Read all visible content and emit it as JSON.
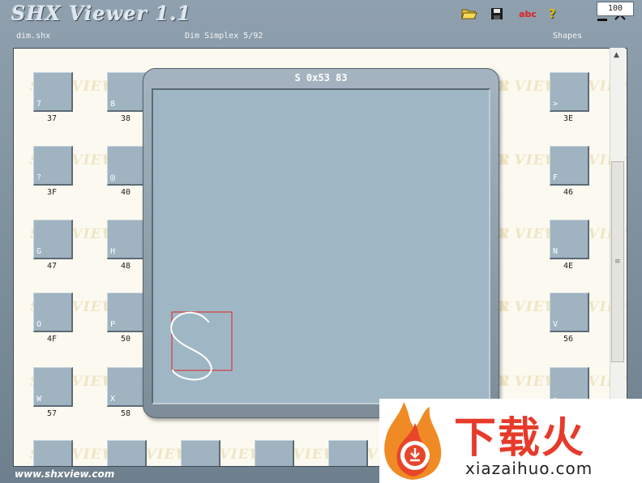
{
  "app": {
    "title": "SHX Viewer 1.1",
    "toolbar": {
      "open_icon": "folder-open-icon",
      "save_icon": "floppy-save-icon",
      "font_label": "abc",
      "help_label": "?"
    },
    "window_controls": {
      "minimize": "minimize-icon",
      "close": "close-icon"
    }
  },
  "status": {
    "file": "dim.shx",
    "font_info": "Dim Simplex 5/92",
    "mode": "Shapes",
    "count": "100"
  },
  "watermark_text": "SHX VIEWER",
  "shapes": {
    "rows": [
      [
        {
          "g": "7",
          "c": "37"
        },
        {
          "g": "8",
          "c": "38"
        },
        null,
        null,
        null,
        null,
        null,
        {
          "g": ">",
          "c": "3E"
        }
      ],
      [
        {
          "g": "?",
          "c": "3F"
        },
        {
          "g": "@",
          "c": "40"
        },
        null,
        null,
        null,
        null,
        null,
        {
          "g": "F",
          "c": "46"
        }
      ],
      [
        {
          "g": "G",
          "c": "47"
        },
        {
          "g": "H",
          "c": "48"
        },
        null,
        null,
        null,
        null,
        null,
        {
          "g": "N",
          "c": "4E"
        }
      ],
      [
        {
          "g": "O",
          "c": "4F"
        },
        {
          "g": "P",
          "c": "50"
        },
        null,
        null,
        null,
        null,
        null,
        {
          "g": "V",
          "c": "56"
        }
      ],
      [
        {
          "g": "W",
          "c": "57"
        },
        {
          "g": "X",
          "c": "58"
        },
        null,
        null,
        null,
        null,
        null,
        {
          "g": "~",
          "c": ""
        }
      ]
    ]
  },
  "preview": {
    "title": "S 0x53 83",
    "glyph_box_color": "#e02020",
    "glyph_stroke_color": "#ffffff"
  },
  "footer": {
    "url": "www.shxview.com"
  },
  "logo": {
    "cn": "下载火",
    "en": "xiazaihuo.com"
  }
}
